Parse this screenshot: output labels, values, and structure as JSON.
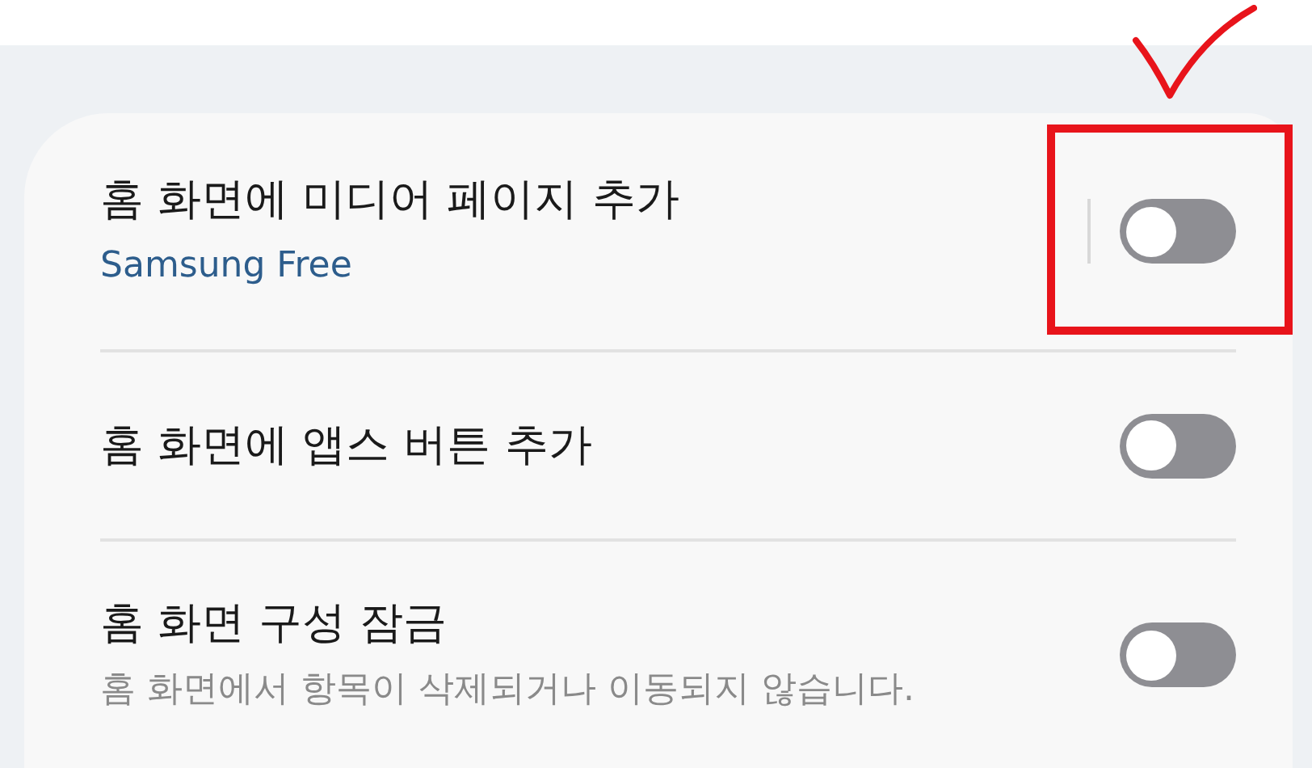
{
  "check_mark": true,
  "rows": [
    {
      "title": "홈 화면에 미디어 페이지 추가",
      "subtitle": {
        "text": "Samsung Free",
        "kind": "link"
      },
      "separator": true,
      "on": false,
      "highlighted": true
    },
    {
      "title": "홈 화면에 앱스 버튼 추가",
      "separator": false,
      "on": false,
      "highlighted": false
    },
    {
      "title": "홈 화면 구성 잠금",
      "subtitle": {
        "text": "홈 화면에서 항목이 삭제되거나 이동되지 않습니다.",
        "kind": "description"
      },
      "separator": false,
      "on": false,
      "highlighted": false
    }
  ]
}
